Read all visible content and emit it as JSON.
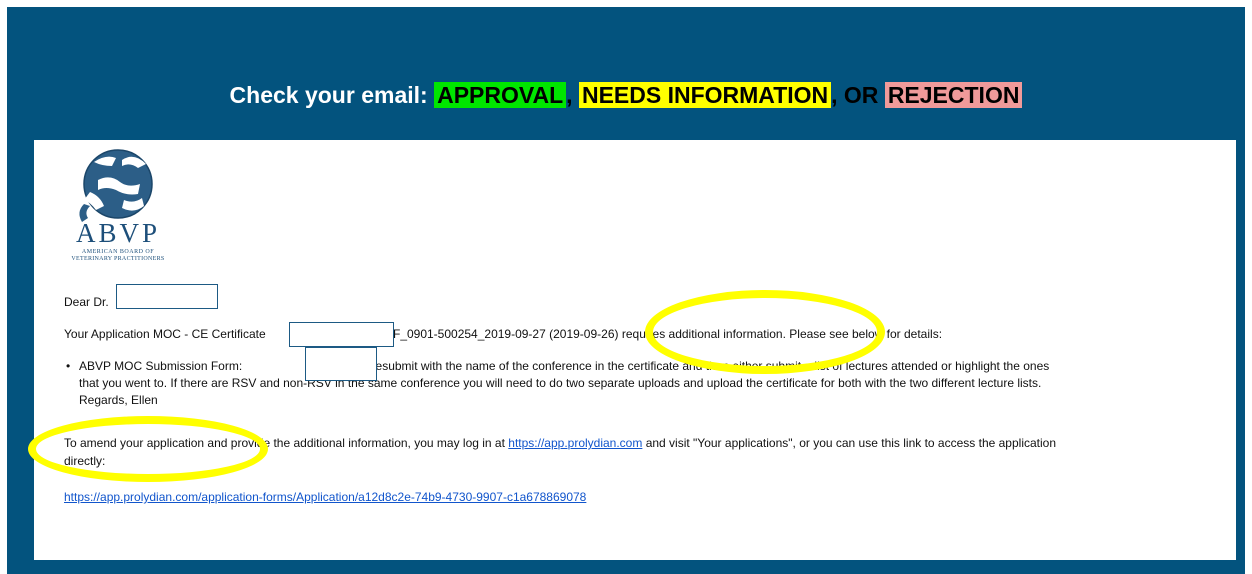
{
  "heading": {
    "prefix": "Check your email: ",
    "approval": "APPROVAL",
    "comma": ",",
    "needs_info": "NEEDS INFORMATION",
    "or": ", OR ",
    "rejection": "REJECTION"
  },
  "colors": {
    "frame_bg": "#03537e",
    "approval_highlight": "#00e600",
    "needs_info_highlight": "#ffff00",
    "rejection_highlight": "#f09a9a",
    "annotation_ring": "#ffff00",
    "link": "#1155cc"
  },
  "logo": {
    "letters": "ABVP",
    "subtitle_1": "AMERICAN BOARD OF",
    "subtitle_2": "VETERINARY PRACTITIONERS",
    "icon": "abvp-animals-globe-icon"
  },
  "email": {
    "greeting": "Dear Dr.",
    "application_prefix": "Your Application MOC - CE Certificate",
    "application_id": "_VDF_0901-500254_2019-09-27 (2019-09-",
    "application_hidden": "26",
    "application_suffix": ") requires additional information. Please see below for details:",
    "bullet_label": "ABVP MOC Submission Form:",
    "bullet_text_1": "Could you resubmit with the name of the conference in the certificate and then either submit a list of lectures attended or highlight the ones",
    "bullet_text_2": "that you went to. If there are RSV and non-RSV in the same conference you will need to do two separate uploads and upload the certificate for both with the two different lecture lists.",
    "bullet_text_3": "Regards, Ellen",
    "amend_1_prefix": "To amend your application and provide the additional information, you may log in at ",
    "amend_link": "https://app.prolydian.com",
    "amend_1_suffix": " and visit \"Your applications\", or you can use this link to access the application",
    "amend_2": "directly:",
    "app_url": "https://app.prolydian.com/application-forms/Application/a12d8c2e-74b9-4730-9907-c1a678869078"
  }
}
